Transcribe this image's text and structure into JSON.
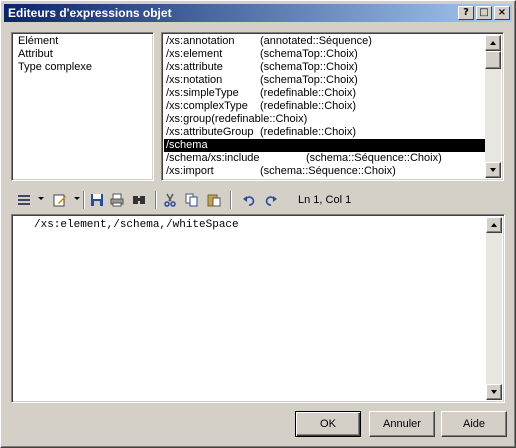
{
  "window": {
    "title": "Editeurs d'expressions objet"
  },
  "categories": {
    "items": [
      {
        "label": "Elément",
        "selected": true
      },
      {
        "label": "Attribut",
        "selected": false
      },
      {
        "label": "Type complexe",
        "selected": false
      }
    ]
  },
  "elements": {
    "rows": [
      {
        "path": "/xs:annotation",
        "type": "(annotated::Séquence)",
        "selected": false
      },
      {
        "path": "/xs:element",
        "type": "(schemaTop::Choix)",
        "selected": false
      },
      {
        "path": "/xs:attribute",
        "type": "(schemaTop::Choix)",
        "selected": false
      },
      {
        "path": "/xs:notation",
        "type": "(schemaTop::Choix)",
        "selected": false
      },
      {
        "path": "/xs:simpleType",
        "type": "(redefinable::Choix)",
        "selected": false
      },
      {
        "path": "/xs:complexType",
        "type": "(redefinable::Choix)",
        "selected": false
      },
      {
        "path": "/xs:group(redefinable::Choix)",
        "type": "",
        "selected": false
      },
      {
        "path": "/xs:attributeGroup",
        "type": "(redefinable::Choix)",
        "selected": false
      },
      {
        "path": "/schema",
        "type": "",
        "selected": true
      },
      {
        "path": "/schema/xs:include",
        "type": "(schema::Séquence::Choix)",
        "selected": false
      },
      {
        "path": "/xs:import",
        "type": "(schema::Séquence::Choix)",
        "selected": false
      }
    ]
  },
  "toolbar": {
    "position": "Ln 1, Col 1",
    "icons": [
      "list-icon",
      "edit-icon",
      "save-icon",
      "print-icon",
      "find-icon",
      "cut-icon",
      "copy-icon",
      "paste-icon",
      "undo-icon",
      "redo-icon"
    ]
  },
  "editor": {
    "text": "/xs:element,/schema,/whiteSpace"
  },
  "buttons": {
    "ok": "OK",
    "cancel": "Annuler",
    "help": "Aide"
  }
}
